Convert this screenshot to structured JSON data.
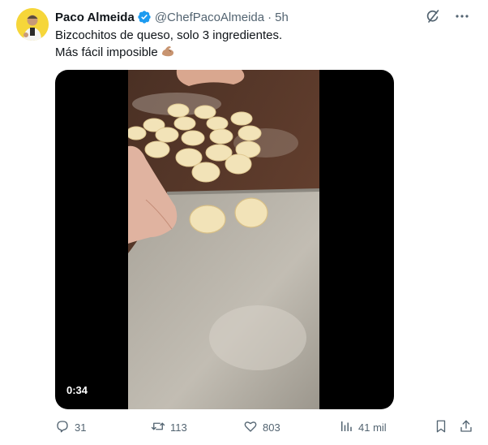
{
  "author": {
    "name": "Paco Almeida",
    "handle": "@ChefPacoAlmeida",
    "time": "5h",
    "separator": "·"
  },
  "tweet": {
    "line1": "Bizcochitos de queso, solo 3 ingredientes.",
    "line2": "Más fácil imposible",
    "emoji": "flexed-biceps-emoji"
  },
  "video": {
    "duration": "0:34"
  },
  "actions": {
    "replies": "31",
    "reposts": "113",
    "likes": "803",
    "views": "41 mil"
  },
  "icons": {
    "verified": "verified-badge-icon",
    "grok": "grok-icon",
    "more": "more-icon",
    "reply": "reply-icon",
    "repost": "repost-icon",
    "like": "like-icon",
    "views": "views-icon",
    "bookmark": "bookmark-icon",
    "share": "share-icon"
  },
  "colors": {
    "verified_blue": "#1d9bf0",
    "muted_text": "#536471",
    "avatar_bg": "#f6d63a"
  }
}
